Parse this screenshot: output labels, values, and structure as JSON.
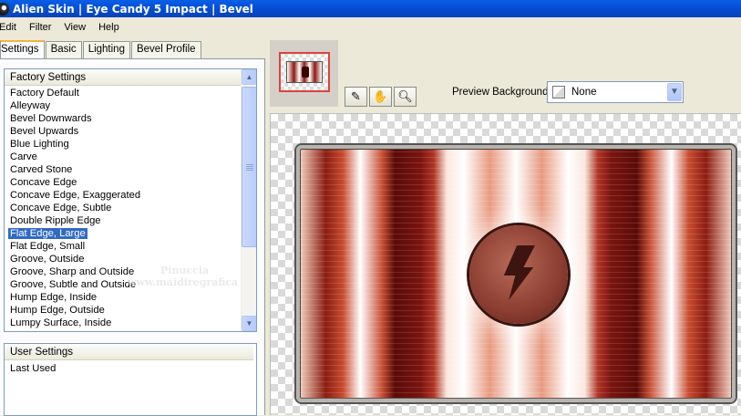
{
  "window": {
    "title": "Alien Skin | Eye Candy 5 Impact | Bevel"
  },
  "menu": [
    "Edit",
    "Filter",
    "View",
    "Help"
  ],
  "tabs": [
    "Settings",
    "Basic",
    "Lighting",
    "Bevel Profile"
  ],
  "factory_settings": {
    "header": "Factory Settings",
    "items": [
      "Factory Default",
      "Alleyway",
      "Bevel Downwards",
      "Bevel Upwards",
      "Blue Lighting",
      "Carve",
      "Carved Stone",
      "Concave Edge",
      "Concave Edge, Exaggerated",
      "Concave Edge, Subtle",
      "Double Ripple Edge",
      "Flat Edge, Large",
      "Flat Edge, Small",
      "Groove, Outside",
      "Groove, Sharp and Outside",
      "Groove, Subtle and Outside",
      "Hump Edge, Inside",
      "Hump Edge, Outside",
      "Lumpy Surface, Inside"
    ],
    "selected": "Flat Edge, Large"
  },
  "user_settings": {
    "header": "User Settings",
    "items": [
      "Last Used"
    ]
  },
  "preview": {
    "background_label": "Preview Background:",
    "background_value": "None",
    "tools": [
      "eye-dropper-icon",
      "hand-icon",
      "zoom-icon"
    ]
  },
  "watermark": {
    "line1": "Pinuccia",
    "line2": "www.maidiregrafica"
  },
  "colors": {
    "titlebar": "#0551d8",
    "selection": "#316ac5",
    "tab_accent": "#f0b43c",
    "artwork_red": "#8b1d12"
  }
}
